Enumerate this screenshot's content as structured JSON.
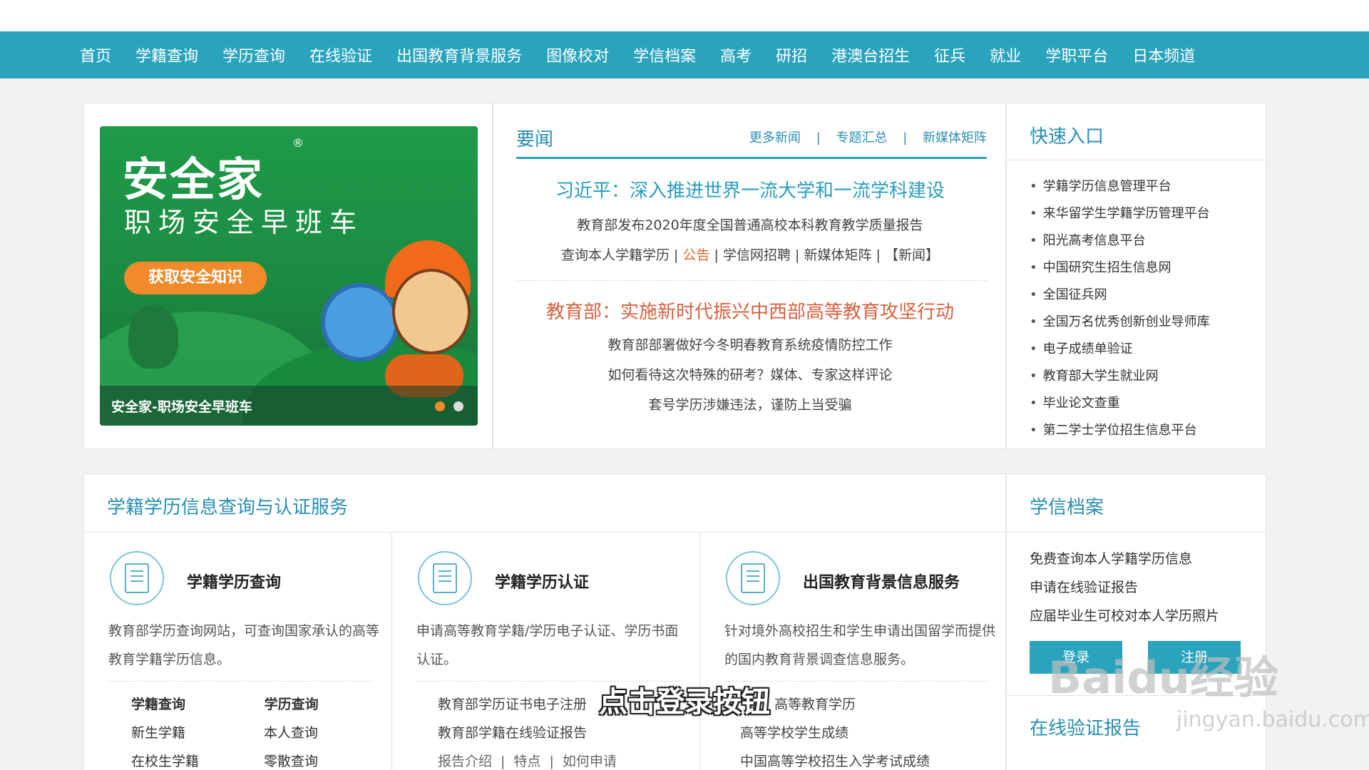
{
  "nav": {
    "items": [
      "首页",
      "学籍查询",
      "学历查询",
      "在线验证",
      "出国教育背景服务",
      "图像校对",
      "学信档案",
      "高考",
      "研招",
      "港澳台招生",
      "征兵",
      "就业",
      "学职平台",
      "日本频道"
    ]
  },
  "banner": {
    "logo_title": "安全家",
    "logo_reg": "®",
    "sub_title": "职场安全早班车",
    "cta_label": "获取安全知识",
    "caption": "安全家-职场安全早班车"
  },
  "news": {
    "title": "要闻",
    "more_links": [
      "更多新闻",
      "专题汇总",
      "新媒体矩阵"
    ],
    "separator": "|",
    "headline1": "习近平：深入推进世界一流大学和一流学科建设",
    "line2": "教育部发布2020年度全国普通高校本科教育教学质量报告",
    "line3_a": "查询本人学籍学历 | ",
    "line3_notice": "公告",
    "line3_b": " | 学信网招聘 | 新媒体矩阵 | 【新闻】",
    "headline2": "教育部：实施新时代振兴中西部高等教育攻坚行动",
    "line5": "教育部部署做好今冬明春教育系统疫情防控工作",
    "line6": "如何看待这次特殊的研考？媒体、专家这样评论",
    "line7": "套号学历涉嫌违法，谨防上当受骗"
  },
  "quick": {
    "title": "快速入口",
    "items": [
      "学籍学历信息管理平台",
      "来华留学生学籍学历管理平台",
      "阳光高考信息平台",
      "中国研究生招生信息网",
      "全国征兵网",
      "全国万名优秀创新创业导师库",
      "电子成绩单验证",
      "教育部大学生就业网",
      "毕业论文查重",
      "第二学士学位招生信息平台"
    ]
  },
  "service": {
    "title": "学籍学历信息查询与认证服务",
    "col1": {
      "name": "学籍学历查询",
      "desc": "教育部学历查询网站，可查询国家承认的高等教育学籍学历信息。",
      "links": [
        [
          "学籍查询",
          "学历查询"
        ],
        [
          "新生学籍",
          "本人查询"
        ],
        [
          "在校生学籍",
          "零散查询"
        ]
      ]
    },
    "col2": {
      "name": "学籍学历认证",
      "desc": "申请高等教育学籍/学历电子认证、学历书面认证。",
      "list": [
        "教育部学历证书电子注册",
        "教育部学籍在线验证报告"
      ],
      "small": [
        "报告介绍",
        "特点",
        "如何申请"
      ]
    },
    "col3": {
      "name": "出国教育背景信息服务",
      "desc": "针对境外高校招生和学生申请出国留学而提供的国内教育背景调查信息服务。",
      "list": [
        "高等教育学历",
        "高等学校学生成绩",
        "中国高等学校招生入学考试成绩"
      ]
    }
  },
  "archive": {
    "title": "学信档案",
    "items": [
      "免费查询本人学籍学历信息",
      "申请在线验证报告",
      "应届毕业生可校对本人学历照片"
    ],
    "login": "登录",
    "register": "注册",
    "title2": "在线验证报告"
  },
  "overlay": {
    "subtitle": "点击登录按钮",
    "watermark": "Baidu经验",
    "watermark_url": "jingyan.baidu.com"
  }
}
